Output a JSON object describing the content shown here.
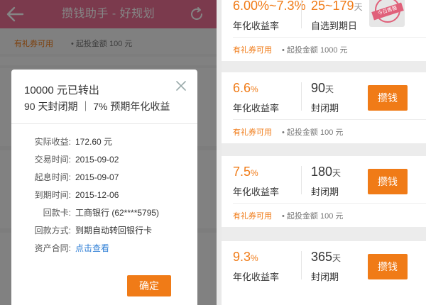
{
  "left": {
    "title": "攒钱助手 - 好规划",
    "coupon": "有礼券可用",
    "min_investment": "起投金额 100 元",
    "modal": {
      "line1": "10000 元已转出",
      "line2": "90 天封闭期 ｜ 7% 预期年化收益",
      "rows": [
        {
          "label": "实际收益:",
          "value": "172.60 元"
        },
        {
          "label": "交易时间:",
          "value": "2015-09-02"
        },
        {
          "label": "起息时间:",
          "value": "2015-09-07"
        },
        {
          "label": "到期时间:",
          "value": "2015-12-06"
        },
        {
          "label": "回款卡:",
          "value": "工商银行 (62****5795)"
        },
        {
          "label": "回款方式:",
          "value": "到期自动转回银行卡"
        },
        {
          "label": "资产合同:",
          "value": "点击查看"
        }
      ],
      "confirm": "确定"
    }
  },
  "right": {
    "stamp_text": "今日售罄",
    "cards": [
      {
        "rate": "6.00%~7.3%",
        "rate_label": "年化收益率",
        "term": "25~179",
        "term_unit": "天",
        "term_label": "自选到期日",
        "coupon": "有礼券可用",
        "min_investment": "起投金额 1000 元",
        "button": ""
      },
      {
        "rate": "6.6",
        "rate_unit": "%",
        "rate_label": "年化收益率",
        "term": "90",
        "term_unit": "天",
        "term_label": "封闭期",
        "coupon": "有礼券可用",
        "min_investment": "起投金额 100 元",
        "button": "攒钱"
      },
      {
        "rate": "7.5",
        "rate_unit": "%",
        "rate_label": "年化收益率",
        "term": "180",
        "term_unit": "天",
        "term_label": "封闭期",
        "coupon": "有礼券可用",
        "min_investment": "起投金额 100 元",
        "button": "攒钱"
      },
      {
        "rate": "9.3",
        "rate_unit": "%",
        "rate_label": "年化收益率",
        "term": "365",
        "term_unit": "天",
        "term_label": "封闭期",
        "coupon": "",
        "min_investment": "",
        "button": "攒钱"
      }
    ]
  },
  "colors": {
    "header_pink": "#ec6f95",
    "accent_orange": "#f07b17",
    "link_blue": "#2f7fd6"
  },
  "icons": [
    "back-arrow-icon",
    "refresh-icon",
    "close-icon",
    "sold-out-stamp-icon"
  ]
}
